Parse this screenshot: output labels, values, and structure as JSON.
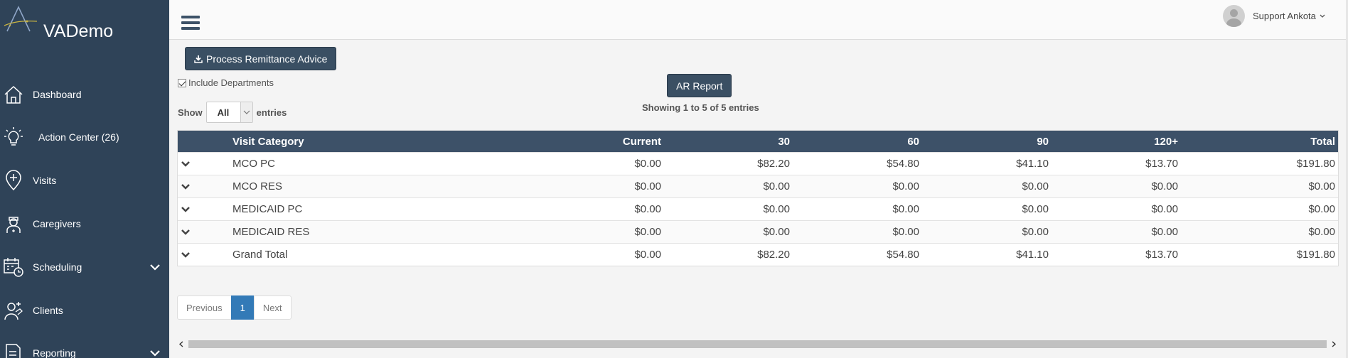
{
  "brand": {
    "name": "VADemo"
  },
  "sidebar": {
    "items": [
      {
        "label": "Dashboard",
        "icon": "home-icon"
      },
      {
        "label": "Action Center (26)",
        "icon": "lightbulb-icon"
      },
      {
        "label": "Visits",
        "icon": "map-pin-plus-icon"
      },
      {
        "label": "Caregivers",
        "icon": "nurse-icon"
      },
      {
        "label": "Scheduling",
        "icon": "calendar-clock-icon",
        "expandable": true
      },
      {
        "label": "Clients",
        "icon": "client-care-icon"
      },
      {
        "label": "Reporting",
        "icon": "report-icon",
        "expandable": true
      }
    ]
  },
  "header": {
    "user_name": "Support Ankota"
  },
  "toolbar": {
    "process_label": "Process Remittance Advice",
    "include_departments_label": "Include Departments",
    "include_departments_checked": true,
    "ar_report_label": "AR Report",
    "show_label": "Show",
    "entries_label": "entries",
    "length_value": "All",
    "info": "Showing 1 to 5 of 5 entries"
  },
  "table": {
    "columns": [
      "Visit Category",
      "Current",
      "30",
      "60",
      "90",
      "120+",
      "Total"
    ],
    "rows": [
      [
        "MCO PC",
        "$0.00",
        "$82.20",
        "$54.80",
        "$41.10",
        "$13.70",
        "$191.80"
      ],
      [
        "MCO RES",
        "$0.00",
        "$0.00",
        "$0.00",
        "$0.00",
        "$0.00",
        "$0.00"
      ],
      [
        "MEDICAID PC",
        "$0.00",
        "$0.00",
        "$0.00",
        "$0.00",
        "$0.00",
        "$0.00"
      ],
      [
        "MEDICAID RES",
        "$0.00",
        "$0.00",
        "$0.00",
        "$0.00",
        "$0.00",
        "$0.00"
      ],
      [
        "Grand Total",
        "$0.00",
        "$82.20",
        "$54.80",
        "$41.10",
        "$13.70",
        "$191.80"
      ]
    ]
  },
  "pagination": {
    "previous": "Previous",
    "current": "1",
    "next": "Next"
  },
  "colors": {
    "sidebar_bg": "#2f4358",
    "header_bg": "#3d5168",
    "button_bg": "#3a4f63",
    "page_active": "#337ab7"
  }
}
